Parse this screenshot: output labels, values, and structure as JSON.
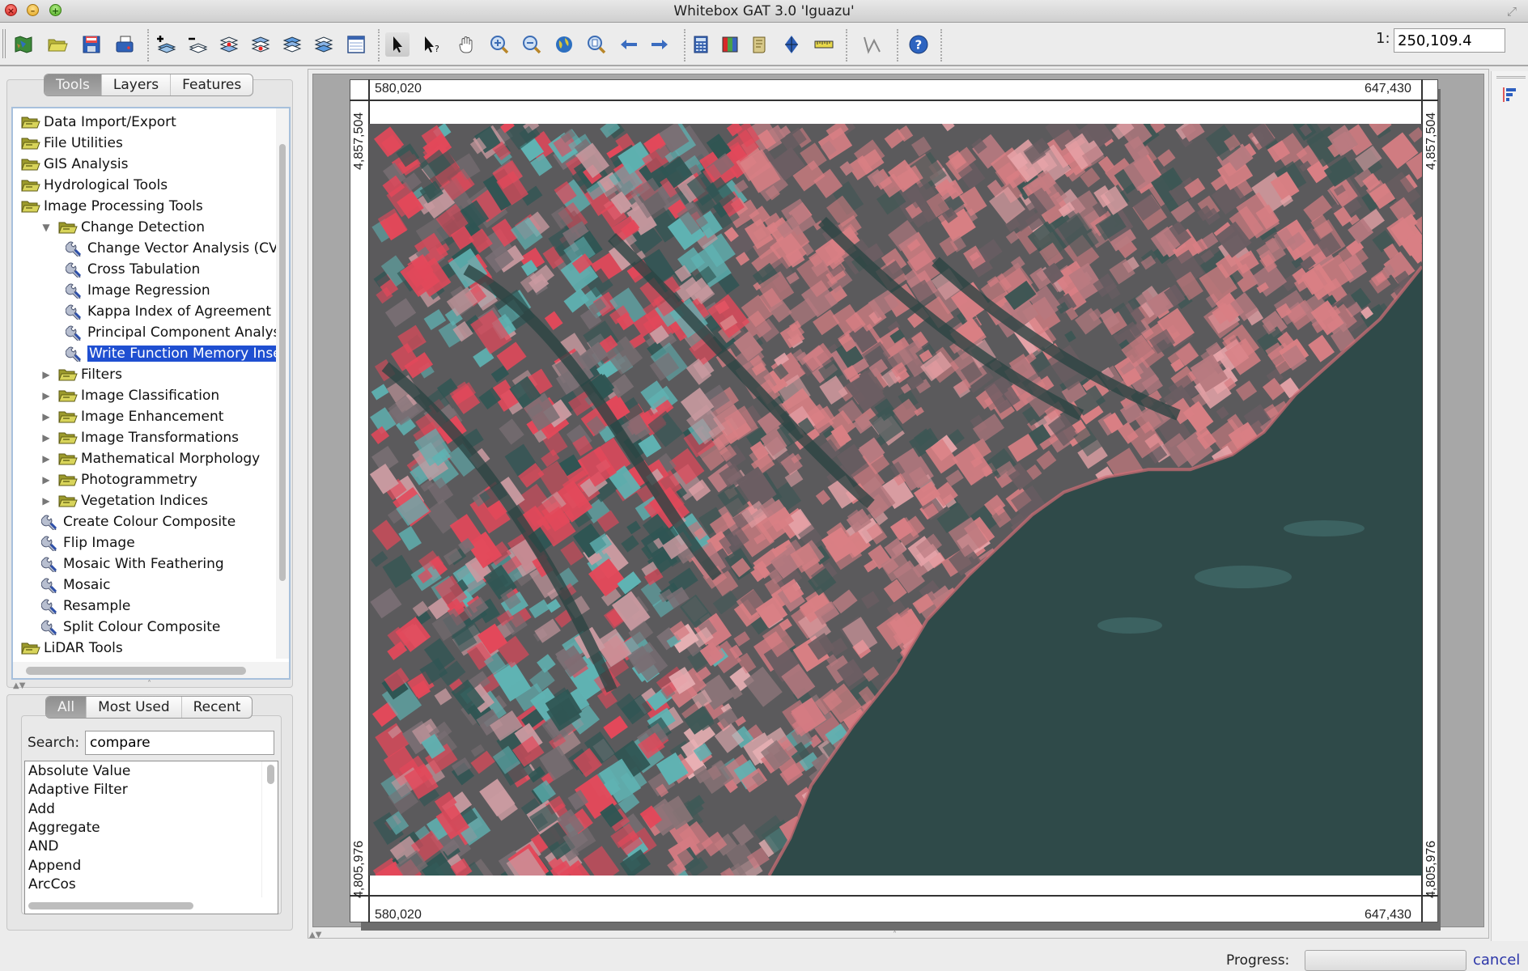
{
  "window": {
    "title": "Whitebox GAT 3.0 'Iguazu'"
  },
  "toolbar": {
    "buttons": [
      {
        "name": "map-icon",
        "tooltip": "New Map"
      },
      {
        "name": "open-folder-icon",
        "tooltip": "Open"
      },
      {
        "name": "save-icon",
        "tooltip": "Save"
      },
      {
        "name": "print-icon",
        "tooltip": "Print"
      },
      {
        "name": "add-layer-icon",
        "tooltip": "Add Layer"
      },
      {
        "name": "remove-layer-icon",
        "tooltip": "Remove Layer"
      },
      {
        "name": "raise-layer-icon",
        "tooltip": "Raise Layer"
      },
      {
        "name": "lower-layer-icon",
        "tooltip": "Lower Layer"
      },
      {
        "name": "layer-to-top-icon",
        "tooltip": "Layer to Top"
      },
      {
        "name": "layer-to-bottom-icon",
        "tooltip": "Layer to Bottom"
      },
      {
        "name": "attribute-table-icon",
        "tooltip": "Attribute Table"
      },
      {
        "name": "select-pointer-icon",
        "tooltip": "Select",
        "active": true
      },
      {
        "name": "identify-pointer-icon",
        "tooltip": "Identify"
      },
      {
        "name": "pan-hand-icon",
        "tooltip": "Pan"
      },
      {
        "name": "zoom-in-icon",
        "tooltip": "Zoom In"
      },
      {
        "name": "zoom-out-icon",
        "tooltip": "Zoom Out"
      },
      {
        "name": "full-extent-globe-icon",
        "tooltip": "Full Extent"
      },
      {
        "name": "zoom-to-layer-icon",
        "tooltip": "Zoom to Layer"
      },
      {
        "name": "previous-extent-icon",
        "tooltip": "Previous Extent"
      },
      {
        "name": "next-extent-icon",
        "tooltip": "Next Extent"
      },
      {
        "name": "raster-calculator-icon",
        "tooltip": "Raster Calculator"
      },
      {
        "name": "palette-manager-icon",
        "tooltip": "Palette Manager"
      },
      {
        "name": "scripting-scroll-icon",
        "tooltip": "Scripting"
      },
      {
        "name": "digitize-point-icon",
        "tooltip": "Digitize"
      },
      {
        "name": "measure-ruler-icon",
        "tooltip": "Measure"
      },
      {
        "name": "edit-vector-icon",
        "tooltip": "Edit Vector"
      },
      {
        "name": "help-icon",
        "tooltip": "Help"
      }
    ],
    "scale_prefix": "1:",
    "scale_value": "250,109.4"
  },
  "left_panel": {
    "tabs": [
      {
        "label": "Tools",
        "selected": true
      },
      {
        "label": "Layers",
        "selected": false
      },
      {
        "label": "Features",
        "selected": false
      }
    ],
    "tree": [
      {
        "label": "Data Import/Export",
        "type": "folder",
        "level": 0
      },
      {
        "label": "File Utilities",
        "type": "folder",
        "level": 0
      },
      {
        "label": "GIS Analysis",
        "type": "folder",
        "level": 0
      },
      {
        "label": "Hydrological Tools",
        "type": "folder",
        "level": 0
      },
      {
        "label": "Image Processing Tools",
        "type": "folder",
        "level": 0
      },
      {
        "label": "Change Detection",
        "type": "folder",
        "level": 1,
        "expanded": true
      },
      {
        "label": "Change Vector Analysis (CVA",
        "type": "tool",
        "level": 2
      },
      {
        "label": "Cross Tabulation",
        "type": "tool",
        "level": 2
      },
      {
        "label": "Image Regression",
        "type": "tool",
        "level": 2
      },
      {
        "label": "Kappa Index of Agreement",
        "type": "tool",
        "level": 2
      },
      {
        "label": "Principal Component Analysi",
        "type": "tool",
        "level": 2
      },
      {
        "label": "Write Function Memory Inser",
        "type": "tool",
        "level": 2,
        "selected": true
      },
      {
        "label": "Filters",
        "type": "folder",
        "level": 1,
        "expanded": false
      },
      {
        "label": "Image Classification",
        "type": "folder",
        "level": 1,
        "expanded": false
      },
      {
        "label": "Image Enhancement",
        "type": "folder",
        "level": 1,
        "expanded": false
      },
      {
        "label": "Image Transformations",
        "type": "folder",
        "level": 1,
        "expanded": false
      },
      {
        "label": "Mathematical Morphology",
        "type": "folder",
        "level": 1,
        "expanded": false
      },
      {
        "label": "Photogrammetry",
        "type": "folder",
        "level": 1,
        "expanded": false
      },
      {
        "label": "Vegetation Indices",
        "type": "folder",
        "level": 1,
        "expanded": false
      },
      {
        "label": "Create Colour Composite",
        "type": "tool",
        "level": 1
      },
      {
        "label": "Flip Image",
        "type": "tool",
        "level": 1
      },
      {
        "label": "Mosaic With Feathering",
        "type": "tool",
        "level": 1
      },
      {
        "label": "Mosaic",
        "type": "tool",
        "level": 1
      },
      {
        "label": "Resample",
        "type": "tool",
        "level": 1
      },
      {
        "label": "Split Colour Composite",
        "type": "tool",
        "level": 1
      },
      {
        "label": "LiDAR Tools",
        "type": "folder",
        "level": 0
      }
    ],
    "filter_tabs": [
      {
        "label": "All",
        "selected": true
      },
      {
        "label": "Most Used",
        "selected": false
      },
      {
        "label": "Recent",
        "selected": false
      }
    ],
    "search": {
      "label": "Search:",
      "value": "compare"
    },
    "tool_list": [
      "Absolute Value",
      "Adaptive Filter",
      "Add",
      "Aggregate",
      "AND",
      "Append",
      "ArcCos"
    ]
  },
  "map": {
    "top_left_x": "580,020",
    "top_right_x": "647,430",
    "bottom_left_x": "580,020",
    "bottom_right_x": "647,430",
    "left_top_y": "4,857,504",
    "left_bottom_y": "4,805,976",
    "right_top_y": "4,857,504",
    "right_bottom_y": "4,805,976",
    "image_description": "false-colour satellite image (red/cyan) of an urban shoreline"
  },
  "status": {
    "progress_label": "Progress:",
    "progress_value": 0,
    "cancel_label": "cancel"
  },
  "colors": {
    "selection": "#1f4fd1",
    "tree_border": "#a7c0dc",
    "cancel_link": "#2b35a8",
    "water": "#2f4a49",
    "urban": "#d97f84",
    "vegetation_red": "#e3485a",
    "cyan_fields": "#5fb3b3"
  }
}
